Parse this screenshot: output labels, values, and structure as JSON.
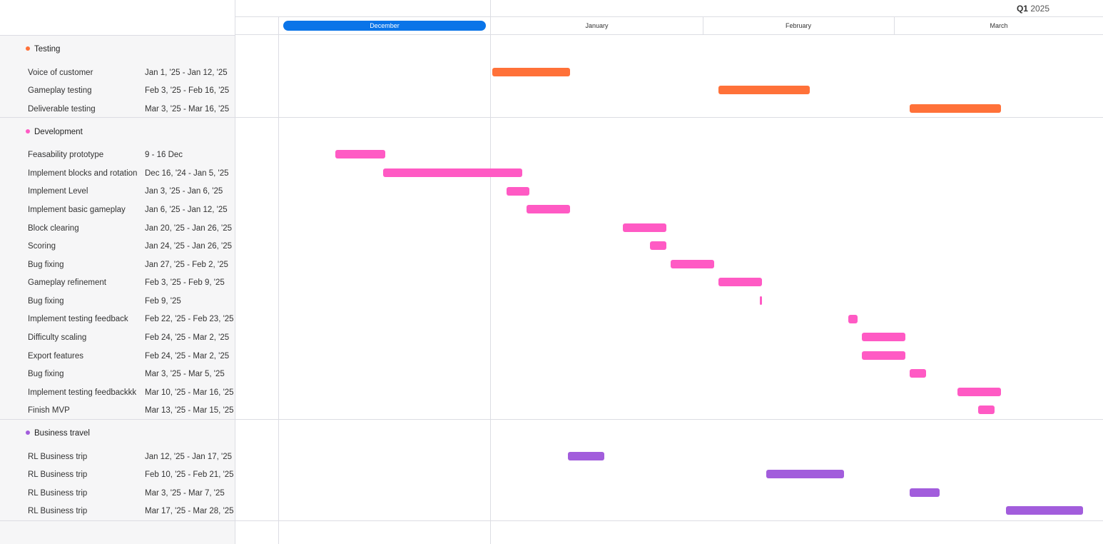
{
  "header": {
    "quarter_bold": "Q1",
    "quarter_year": "2025",
    "months": [
      "December",
      "January",
      "February",
      "March"
    ]
  },
  "colors": {
    "accent": "#0a74e8",
    "testing": "#ff7139",
    "development": "#ff5ac4",
    "business_travel": "#a25ddc"
  },
  "groups": [
    {
      "name": "Testing",
      "color": "#ff7139",
      "tasks": [
        {
          "name": "Voice of customer",
          "dates": "Jan 1, '25 - Jan 12, '25"
        },
        {
          "name": "Gameplay testing",
          "dates": "Feb 3, '25 - Feb 16, '25"
        },
        {
          "name": "Deliverable testing",
          "dates": "Mar 3, '25 - Mar 16, '25"
        }
      ]
    },
    {
      "name": "Development",
      "color": "#ff5ac4",
      "tasks": [
        {
          "name": "Feasability prototype",
          "dates": "9 - 16 Dec"
        },
        {
          "name": "Implement blocks and rotation",
          "dates": "Dec 16, '24 - Jan 5, '25"
        },
        {
          "name": "Implement Level",
          "dates": "Jan 3, '25 - Jan 6, '25"
        },
        {
          "name": "Implement basic gameplay",
          "dates": "Jan 6, '25 - Jan 12, '25"
        },
        {
          "name": "Block clearing",
          "dates": "Jan 20, '25 - Jan 26, '25"
        },
        {
          "name": "Scoring",
          "dates": "Jan 24, '25 - Jan 26, '25"
        },
        {
          "name": "Bug fixing",
          "dates": "Jan 27, '25 - Feb 2, '25"
        },
        {
          "name": "Gameplay refinement",
          "dates": "Feb 3, '25 - Feb 9, '25"
        },
        {
          "name": "Bug fixing",
          "dates": "Feb 9, '25"
        },
        {
          "name": "Implement testing feedback",
          "dates": "Feb 22, '25 - Feb 23, '25"
        },
        {
          "name": "Difficulty scaling",
          "dates": "Feb 24, '25 - Mar 2, '25"
        },
        {
          "name": "Export features",
          "dates": "Feb 24, '25 - Mar 2, '25"
        },
        {
          "name": "Bug fixing",
          "dates": "Mar 3, '25 - Mar 5, '25"
        },
        {
          "name": "Implement testing feedbackkk",
          "dates": "Mar 10, '25 - Mar 16, '25"
        },
        {
          "name": "Finish MVP",
          "dates": "Mar 13, '25 - Mar 15, '25"
        }
      ]
    },
    {
      "name": "Business travel",
      "color": "#a25ddc",
      "tasks": [
        {
          "name": "RL Business trip",
          "dates": "Jan 12, '25 - Jan 17, '25"
        },
        {
          "name": "RL Business trip",
          "dates": "Feb 10, '25 - Feb 21, '25"
        },
        {
          "name": "RL Business trip",
          "dates": "Mar 3, '25 - Mar 7, '25"
        },
        {
          "name": "RL Business trip",
          "dates": "Mar 17, '25 - Mar 28, '25"
        }
      ]
    }
  ]
}
